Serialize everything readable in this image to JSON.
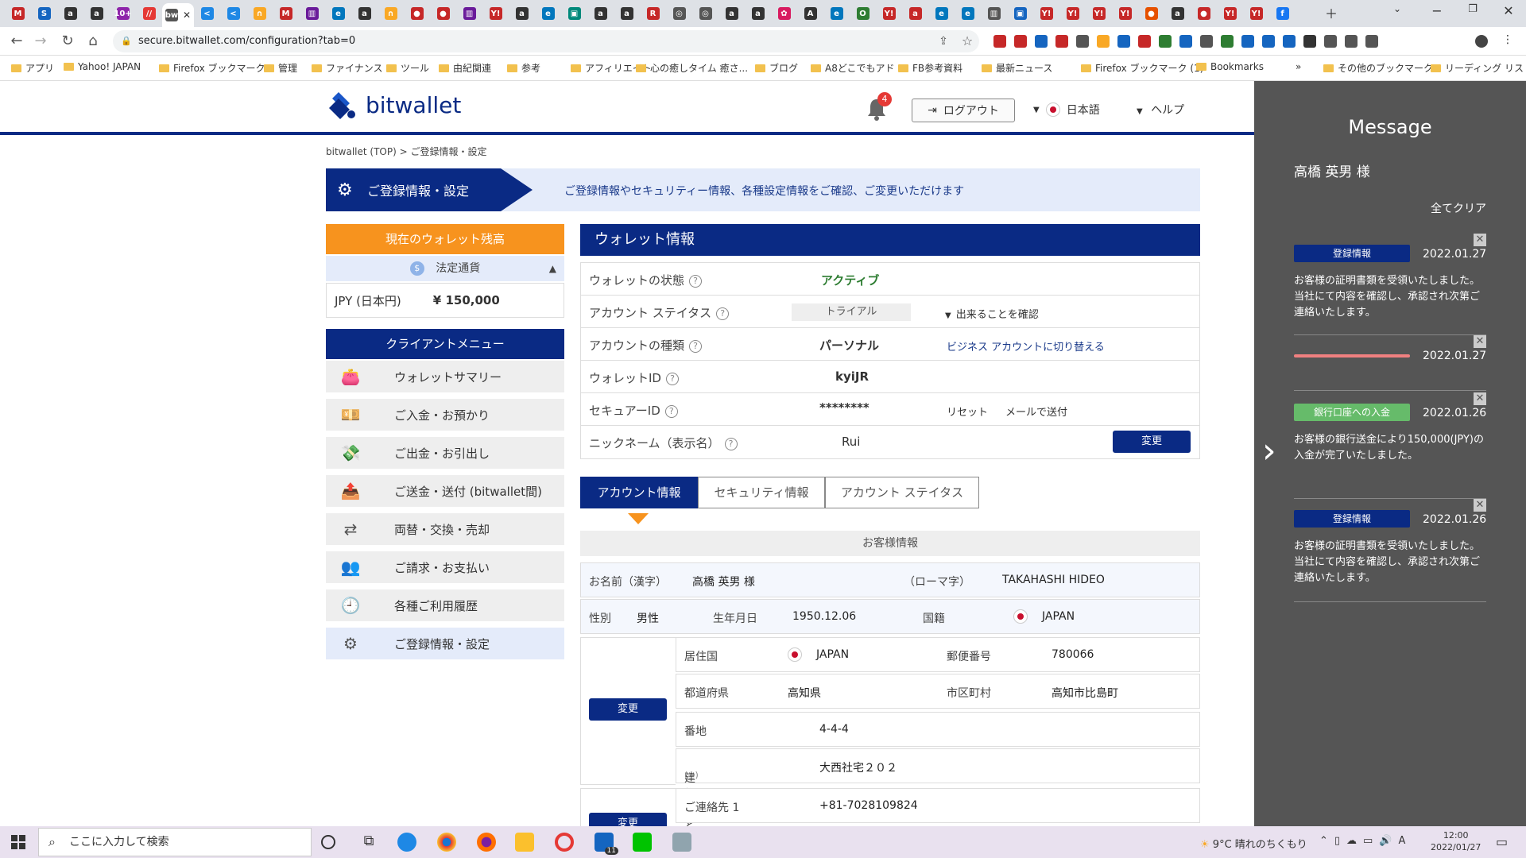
{
  "browser": {
    "url": "secure.bitwallet.com/configuration?tab=0",
    "tabs": [
      "M",
      "S",
      "a",
      "a",
      "10+",
      "//",
      "bw",
      "<",
      "<",
      "∩",
      "M",
      "▥",
      "e",
      "a",
      "∩",
      "●",
      "●",
      "▥",
      "Y!",
      "a",
      "e",
      "▣",
      "a",
      "a",
      "R",
      "◎",
      "◎",
      "a",
      "a",
      "✿",
      "A",
      "e",
      "O",
      "Y!",
      "a",
      "e",
      "e",
      "▥",
      "▣",
      "Y!",
      "Y!",
      "Y!",
      "Y!",
      "●",
      "a",
      "●",
      "Y!",
      "Y!",
      "f"
    ],
    "bookmarks": [
      "アプリ",
      "Yahoo! JAPAN",
      "Firefox ブックマーク",
      "管理",
      "ファイナンス",
      "ツール",
      "由紀関連",
      "参考",
      "アフィリエイト",
      "心の癒しタイム 癒さ...",
      "ブログ",
      "A8どこでもアド",
      "FB参考資料",
      "最新ニュース",
      "Firefox ブックマーク (1)",
      "Bookmarks",
      "その他のブックマーク",
      "リーディング リスト"
    ]
  },
  "header": {
    "logo": "bitwallet",
    "notif_count": "4",
    "logout": "ログアウト",
    "language": "日本語",
    "help": "ヘルプ"
  },
  "breadcrumb": "bitwallet (TOP)  >  ご登録情報・設定",
  "hero": {
    "title": "ご登録情報・設定",
    "desc": "ご登録情報やセキュリティー情報、各種設定情報をご確認、ご変更いただけます"
  },
  "balance": {
    "title": "現在のウォレット残高",
    "fiat_label": "法定通貨",
    "currency": "JPY (日本円)",
    "amount": "¥ 150,000"
  },
  "client_menu": {
    "title": "クライアントメニュー",
    "items": [
      "ウォレットサマリー",
      "ご入金・お預かり",
      "ご出金・お引出し",
      "ご送金・送付 (bitwallet間)",
      "両替・交換・売却",
      "ご請求・お支払い",
      "各種ご利用履歴",
      "ご登録情報・設定"
    ]
  },
  "wallet": {
    "title": "ウォレット情報",
    "status_label": "ウォレットの状態",
    "status_value": "アクティブ",
    "account_status_label": "アカウント ステイタス",
    "account_status_value": "トライアル",
    "account_status_link": "出来ることを確認",
    "account_type_label": "アカウントの種類",
    "account_type_value": "パーソナル",
    "account_type_link": "ビジネス アカウントに切り替える",
    "wallet_id_label": "ウォレットID",
    "wallet_id_value": "kyiJR",
    "secure_id_label": "セキュアーID",
    "secure_id_value": "********",
    "reset": "リセット",
    "email_send": "メールで送付",
    "nickname_label": "ニックネーム（表示名）",
    "nickname_value": "Rui",
    "change": "変更"
  },
  "tabs": [
    "アカウント情報",
    "セキュリティ情報",
    "アカウント ステイタス"
  ],
  "customer": {
    "title": "お客様情報",
    "name_kanji_label": "お名前（漢字）",
    "name_kanji": "高橋 英男 様",
    "name_roman_label": "（ローマ字）",
    "name_roman": "TAKAHASHI HIDEO",
    "gender_label": "性別",
    "gender": "男性",
    "dob_label": "生年月日",
    "dob": "1950.12.06",
    "nationality_label": "国籍",
    "nationality": "JAPAN",
    "country_label": "居住国",
    "country": "JAPAN",
    "postal_label": "郵便番号",
    "postal": "780066",
    "pref_label": "都道府県",
    "pref": "高知県",
    "city_label": "市区町村",
    "city": "高知市比島町",
    "address_label": "番地",
    "address": "4-4-4",
    "building_label": "建物など",
    "building_note": "(※)",
    "building": "大西社宅２０２",
    "contact_label": "ご連絡先 1",
    "contact": "+81-7028109824",
    "change": "変更"
  },
  "messages": {
    "title": "Message",
    "user": "高橋 英男 様",
    "clear_all": "全てクリア",
    "items": [
      {
        "tag": "登録情報",
        "date": "2022.01.27",
        "body": "お客様の証明書類を受領いたしました。当社にて内容を確認し、承認され次第ご連絡いたします。",
        "color": "#0a2a84"
      },
      {
        "tag": "",
        "date": "2022.01.27",
        "body": "",
        "color": "#f08080"
      },
      {
        "tag": "銀行口座への入金",
        "date": "2022.01.26",
        "body": "お客様の銀行送金により150,000(JPY)の入金が完了いたしました。",
        "color": "#66bb6a"
      },
      {
        "tag": "登録情報",
        "date": "2022.01.26",
        "body": "お客様の証明書類を受領いたしました。当社にて内容を確認し、承認され次第ご連絡いたします。",
        "color": "#0a2a84"
      }
    ]
  },
  "taskbar": {
    "search_placeholder": "ここに入力して検索",
    "weather": "9°C  晴れのちくもり",
    "time": "12:00",
    "date": "2022/01/27",
    "mail_count": "11"
  }
}
